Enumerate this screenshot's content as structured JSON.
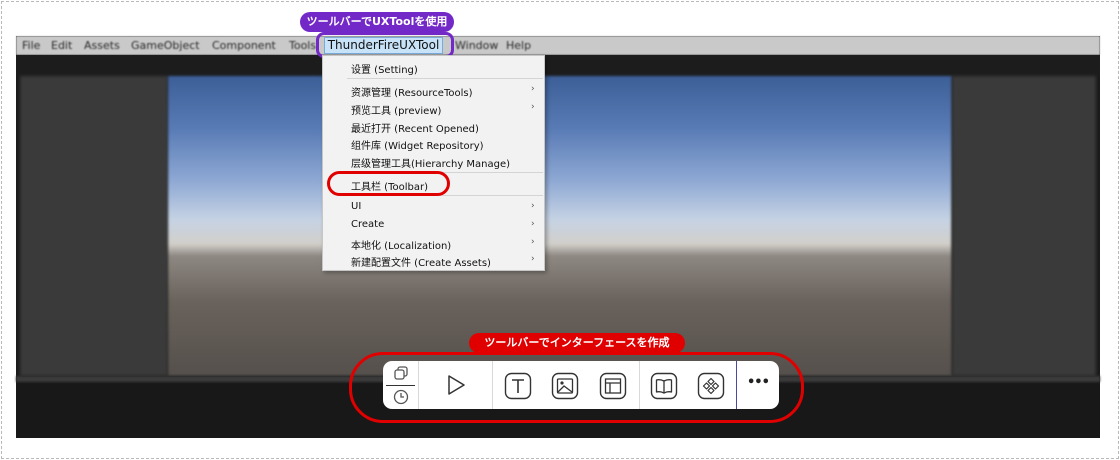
{
  "badges": {
    "top": "ツールバーでUXToolを使用",
    "bottom": "ツールバーでインターフェースを作成"
  },
  "menubar": {
    "items": [
      "File",
      "Edit",
      "Assets",
      "GameObject",
      "Component",
      "Tools",
      "ThunderFireUXTool",
      "Window",
      "Help"
    ]
  },
  "dropdown": {
    "setting": "设置 (Setting)",
    "resource_tools": "资源管理 (ResourceTools)",
    "preview": "预览工具 (preview)",
    "recent_opened": "最近打开 (Recent Opened)",
    "widget_repository": "组件库 (Widget Repository)",
    "hierarchy_manage": "层级管理工具(Hierarchy Manage)",
    "toolbar": "工具栏 (Toolbar)",
    "ui": "UI",
    "create": "Create",
    "localization": "本地化 (Localization)",
    "create_assets": "新建配置文件 (Create Assets)",
    "submenu_arrow": "›"
  },
  "toolbar": {
    "more": "•••"
  },
  "icons": [
    "duplicate-icon",
    "clock-icon",
    "play-icon",
    "text-icon",
    "image-icon",
    "layout-icon",
    "book-icon",
    "widget-icon",
    "more-icon"
  ],
  "colors": {
    "purple": "#7329c7",
    "red": "#e10000",
    "menu_highlight": "#c8e2f8"
  }
}
